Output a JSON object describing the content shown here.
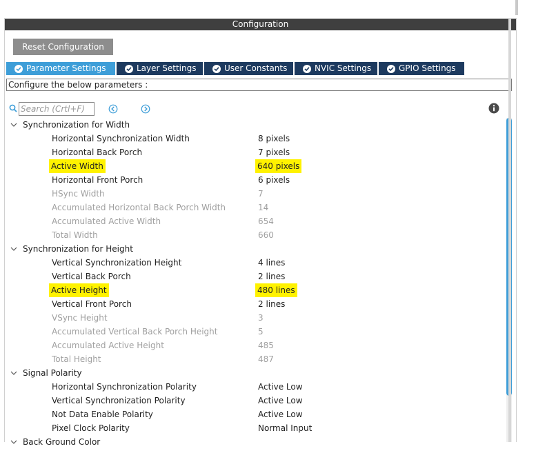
{
  "panel": {
    "title": "Configuration",
    "reset_label": "Reset Configuration"
  },
  "tabs": [
    {
      "label": "Parameter Settings",
      "active": true
    },
    {
      "label": "Layer Settings",
      "active": false
    },
    {
      "label": "User Constants",
      "active": false
    },
    {
      "label": "NVIC Settings",
      "active": false
    },
    {
      "label": "GPIO Settings",
      "active": false
    }
  ],
  "configure_text": "Configure the below parameters :",
  "search": {
    "placeholder": "Search (Crtl+F)"
  },
  "groups": [
    {
      "label": "Synchronization for Width",
      "params": [
        {
          "name": "Horizontal Synchronization Width",
          "value": "8 pixels"
        },
        {
          "name": "Horizontal Back Porch",
          "value": "7 pixels"
        },
        {
          "name": "Active Width",
          "value": "640 pixels"
        },
        {
          "name": "Horizontal Front Porch",
          "value": "6 pixels"
        },
        {
          "name": "HSync Width",
          "value": "7"
        },
        {
          "name": "Accumulated Horizontal Back Porch Width",
          "value": "14"
        },
        {
          "name": "Accumulated Active Width",
          "value": "654"
        },
        {
          "name": "Total Width",
          "value": "660"
        }
      ]
    },
    {
      "label": "Synchronization for Height",
      "params": [
        {
          "name": "Vertical Synchronization Height",
          "value": "4 lines"
        },
        {
          "name": "Vertical Back Porch",
          "value": "2 lines"
        },
        {
          "name": "Active Height",
          "value": "480 lines"
        },
        {
          "name": "Vertical Front Porch",
          "value": "2 lines"
        },
        {
          "name": "VSync Height",
          "value": "3"
        },
        {
          "name": "Accumulated Vertical Back Porch Height",
          "value": "5"
        },
        {
          "name": "Accumulated Active Height",
          "value": "485"
        },
        {
          "name": "Total Height",
          "value": "487"
        }
      ]
    },
    {
      "label": "Signal Polarity",
      "params": [
        {
          "name": "Horizontal Synchronization Polarity",
          "value": "Active Low"
        },
        {
          "name": "Vertical Synchronization Polarity",
          "value": "Active Low"
        },
        {
          "name": "Not Data Enable Polarity",
          "value": "Active Low"
        },
        {
          "name": "Pixel Clock Polarity",
          "value": "Normal Input"
        }
      ]
    }
  ],
  "partial_group_label": "Back Ground Color",
  "colors": {
    "highlight": "#fff200",
    "tab_active": "#3e9ed8",
    "tab_inactive": "#1d3a5f",
    "header": "#3f3f3f"
  }
}
